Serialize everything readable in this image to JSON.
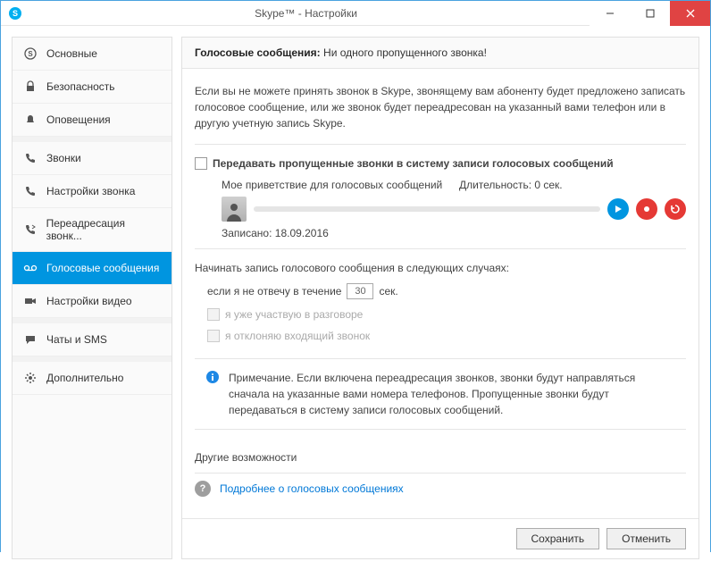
{
  "window": {
    "title": "Skype™ - Настройки"
  },
  "sidebar": {
    "items": [
      {
        "label": "Основные"
      },
      {
        "label": "Безопасность"
      },
      {
        "label": "Оповещения"
      },
      {
        "label": "Звонки"
      },
      {
        "label": "Настройки звонка"
      },
      {
        "label": "Переадресация звонк..."
      },
      {
        "label": "Голосовые сообщения"
      },
      {
        "label": "Настройки видео"
      },
      {
        "label": "Чаты и SMS"
      },
      {
        "label": "Дополнительно"
      }
    ]
  },
  "header": {
    "label": "Голосовые сообщения:",
    "sub": "Ни одного пропущенного звонка!"
  },
  "content": {
    "intro": "Если вы не можете принять звонок в Skype, звонящему вам абоненту будет предложено записать голосовое сообщение, или же звонок будет переадресован на указанный вами телефон или в другую учетную запись Skype.",
    "forward_label": "Передавать пропущенные звонки в систему записи голосовых сообщений",
    "greeting_label": "Мое приветствие для голосовых сообщений",
    "duration_label": "Длительность: 0 сек.",
    "recorded_label": "Записано: 18.09.2016",
    "start_label": "Начинать запись голосового сообщения в следующих случаях:",
    "noanswer_prefix": "если я не отвечу в течение",
    "noanswer_value": "30",
    "noanswer_suffix": "сек.",
    "busy_label": "я уже участвую в разговоре",
    "reject_label": "я отклоняю входящий звонок",
    "note": "Примечание. Если включена переадресация звонков, звонки будут направляться сначала на указанные вами номера телефонов. Пропущенные звонки будут передаваться в систему записи голосовых сообщений.",
    "other_title": "Другие возможности",
    "link": "Подробнее о голосовых сообщениях"
  },
  "footer": {
    "save": "Сохранить",
    "cancel": "Отменить"
  }
}
